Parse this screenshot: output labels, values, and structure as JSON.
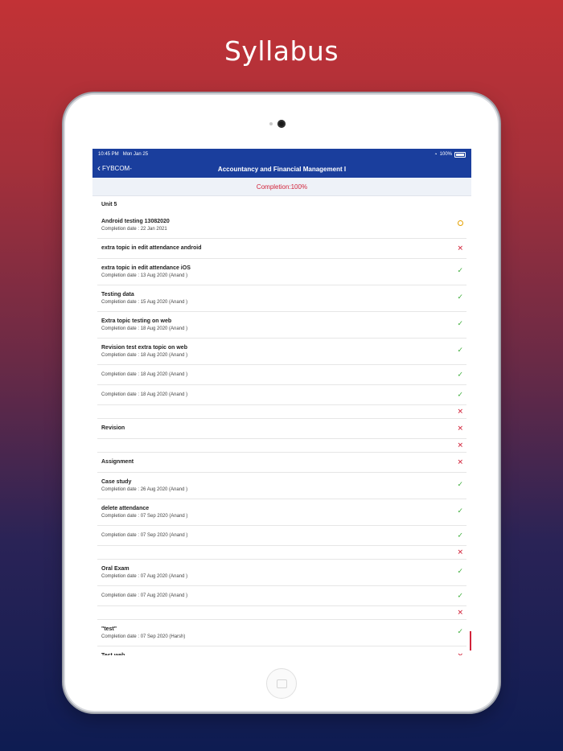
{
  "promo": {
    "title": "Syllabus"
  },
  "statusbar": {
    "time": "10:45 PM",
    "date": "Mon Jan 25",
    "battery": "100%"
  },
  "navbar": {
    "back_label": "FYBCOM-",
    "title": "Accountancy and Financial Management I"
  },
  "completion": "Completion:100%",
  "unit": "Unit 5",
  "rows": [
    {
      "title": "Android testing 13082020",
      "date": "Completion date : 22 Jan 2021",
      "status": "pending"
    },
    {
      "title": "extra topic in edit attendance android",
      "date": "",
      "status": "cross"
    },
    {
      "title": "extra topic in edit attendance iOS",
      "date": "Completion date : 13 Aug 2020 (Anand )",
      "status": "check"
    },
    {
      "title": "Testing data",
      "date": "Completion date : 15 Aug 2020 (Anand )",
      "status": "check"
    },
    {
      "title": "Extra topic testing on web",
      "date": "Completion date : 18 Aug 2020 (Anand )",
      "status": "check"
    },
    {
      "title": "Revision test extra topic on web",
      "date": "Completion date : 18 Aug 2020 (Anand )",
      "status": "check"
    },
    {
      "title": "",
      "date": "Completion date : 18 Aug 2020 (Anand )",
      "status": "check"
    },
    {
      "title": "",
      "date": "Completion date : 18 Aug 2020 (Anand )",
      "status": "check"
    },
    {
      "title": "",
      "date": "",
      "status": "cross"
    },
    {
      "title": "Revision",
      "date": "",
      "status": "cross"
    },
    {
      "title": "",
      "date": "",
      "status": "cross"
    },
    {
      "title": "Assignment",
      "date": "",
      "status": "cross"
    },
    {
      "title": "Case study",
      "date": "Completion date : 26 Aug 2020 (Anand )",
      "status": "check"
    },
    {
      "title": "delete attendance",
      "date": "Completion date : 07 Sep 2020 (Anand )",
      "status": "check"
    },
    {
      "title": "",
      "date": "Completion date : 07 Sep 2020 (Anand )",
      "status": "check"
    },
    {
      "title": "",
      "date": "",
      "status": "cross"
    },
    {
      "title": "Oral Exam",
      "date": "Completion date : 07 Aug 2020 (Anand )",
      "status": "check"
    },
    {
      "title": "",
      "date": "Completion date : 07 Aug 2020 (Anand )",
      "status": "check"
    },
    {
      "title": "",
      "date": "",
      "status": "cross"
    },
    {
      "title": "\"test\"",
      "date": "Completion date : 07 Sep 2020 (Harsh)",
      "status": "check"
    },
    {
      "title": "Test web",
      "date": "",
      "status": "cross"
    }
  ],
  "icons": {
    "check": "check-icon",
    "cross": "cross-icon",
    "pending": "pending-circle-icon"
  },
  "colors": {
    "navbar": "#1a3e9d",
    "completion_text": "#d2233a",
    "check": "#3fae3c",
    "cross": "#d2233a",
    "pending": "#e5a100"
  }
}
